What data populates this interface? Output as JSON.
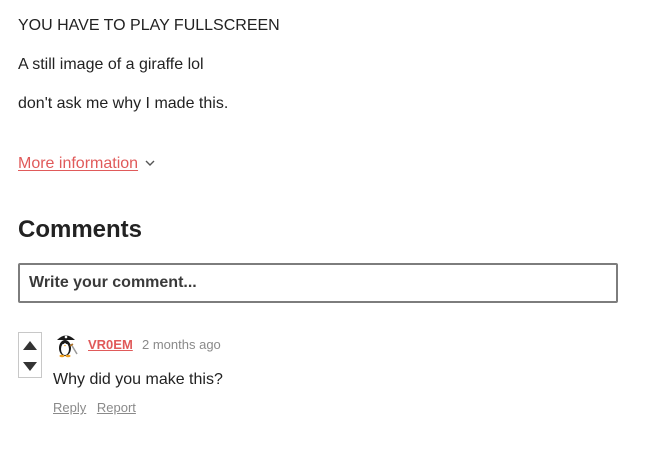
{
  "description": {
    "lines": [
      "YOU HAVE TO PLAY FULLSCREEN",
      "A still image of a giraffe lol",
      "don't ask me why I made this."
    ],
    "more_info_label": "More information",
    "more_info_icon": "chevron-down-icon"
  },
  "comments": {
    "title": "Comments",
    "input_placeholder": "Write your comment...",
    "items": [
      {
        "author": "VR0EM",
        "time": "2 months ago",
        "text": "Why did you make this?",
        "avatar_icon": "penguin-pirate-avatar",
        "actions": {
          "reply": "Reply",
          "report": "Report"
        },
        "upvote_icon": "triangle-up-icon",
        "downvote_icon": "triangle-down-icon"
      }
    ]
  },
  "colors": {
    "accent": "#e05a5a",
    "text": "#222222",
    "muted": "#8a8a8a",
    "border": "#7d7d7d"
  }
}
